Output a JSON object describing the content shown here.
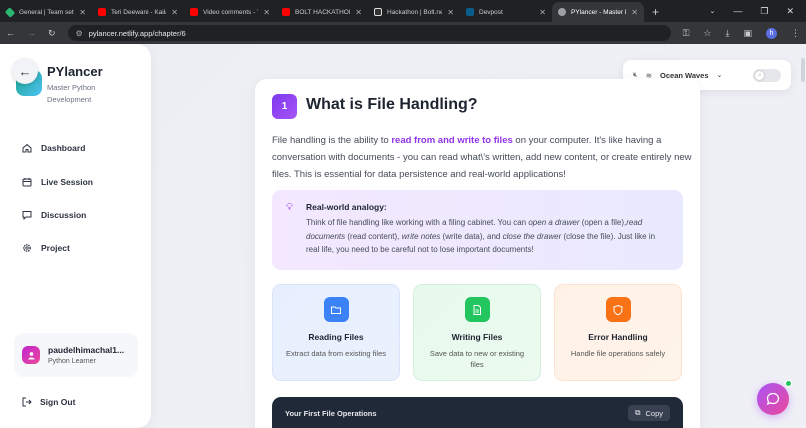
{
  "browser": {
    "tabs": [
      {
        "title": "General | Team settin",
        "favicon_color": "#2bb673"
      },
      {
        "title": "Teri Deewani - Kailas",
        "favicon_color": "#ff0000"
      },
      {
        "title": "Video comments - Yo",
        "favicon_color": "#ff0000"
      },
      {
        "title": "BOLT HACKATHON !!",
        "favicon_color": "#ff0000"
      },
      {
        "title": "Hackathon | Bolt.new",
        "favicon_color": "#dddddd"
      },
      {
        "title": "Devpost",
        "favicon_color": "#0a5c8a"
      },
      {
        "title": "PYlancer - Master Py",
        "favicon_color": "#9aa0a6"
      }
    ],
    "url": "pylancer.netlify.app/chapter/6",
    "profile_initial": "h"
  },
  "sidebar": {
    "brand_name": "PYlancer",
    "brand_sub": "Master Python Development",
    "nav": [
      {
        "label": "Dashboard",
        "icon": "home-icon"
      },
      {
        "label": "Live Session",
        "icon": "calendar-icon"
      },
      {
        "label": "Discussion",
        "icon": "message-icon"
      },
      {
        "label": "Project",
        "icon": "gear-icon"
      }
    ],
    "user": {
      "name": "paudelhimachal1...",
      "role": "Python Learner"
    },
    "signout_label": "Sign Out"
  },
  "audio": {
    "track": "Ocean Waves"
  },
  "lesson": {
    "number": "1",
    "title": "What is File Handling?",
    "intro_before": "File handling is the ability to ",
    "intro_highlight": "read from and write to files",
    "intro_after": " on your computer. It's like having a conversation with documents - you can read what\\'s written, add new content, or create entirely new files. This is essential for data persistence and real-world applications!",
    "analogy": {
      "title": "Real-world analogy:",
      "t1": "Think of file handling like working with a filing cabinet. You can ",
      "e1": "open a drawer",
      "t2": " (open a file),",
      "e2": "read documents",
      "t3": " (read content), ",
      "e3": "write notes",
      "t4": " (write data), and ",
      "e4": "close the drawer",
      "t5": " (close the file). Just like in real life, you need to be careful not to lose important documents!"
    },
    "features": [
      {
        "title": "Reading Files",
        "desc": "Extract data from existing files",
        "color": "#3b82f6"
      },
      {
        "title": "Writing Files",
        "desc": "Save data to new or existing files",
        "color": "#22c55e"
      },
      {
        "title": "Error Handling",
        "desc": "Handle file operations safely",
        "color": "#f97316"
      }
    ],
    "code": {
      "title": "Your First File Operations",
      "copy_label": "Copy"
    }
  }
}
